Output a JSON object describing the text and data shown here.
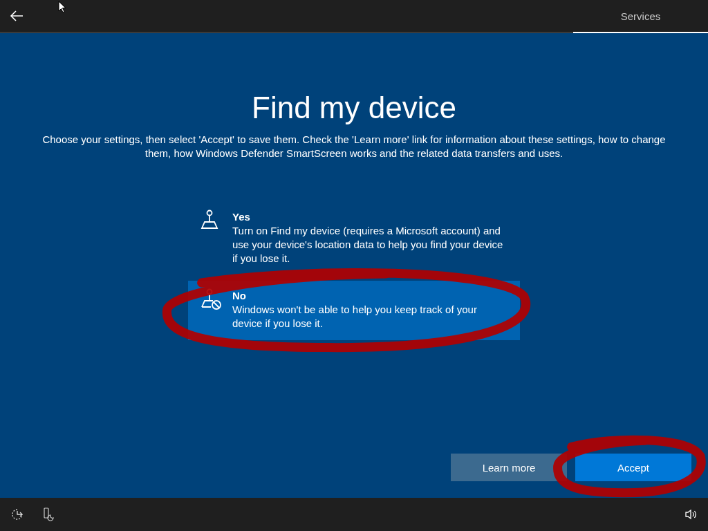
{
  "tabs": [
    {
      "label": "Services",
      "selected": true
    }
  ],
  "title": "Find my device",
  "description": "Choose your settings, then select 'Accept' to save them. Check the 'Learn more' link for information about these settings, how to change them, how Windows Defender SmartScreen works and the related data transfers and uses.",
  "options": [
    {
      "kind": "on",
      "title": "Yes",
      "description": "Turn on Find my device (requires a Microsoft account) and use your device's location data to help you find your device if you lose it.",
      "selected": false
    },
    {
      "kind": "off",
      "title": "No",
      "description": "Windows won't be able to help you keep track of your device if you lose it.",
      "selected": true
    }
  ],
  "buttons": [
    {
      "kind": "secondary",
      "label": "Learn more"
    },
    {
      "kind": "primary",
      "label": "Accept"
    }
  ]
}
